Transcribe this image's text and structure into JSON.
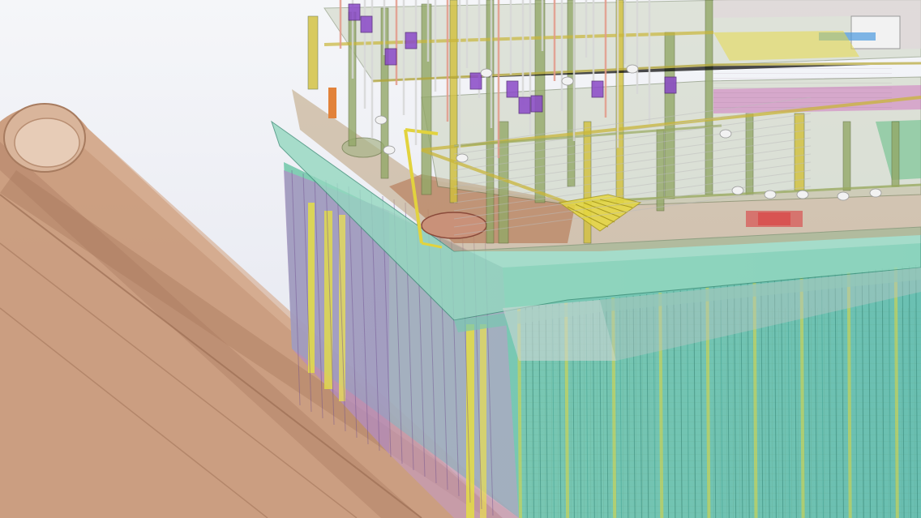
{
  "scene": {
    "view": "3d-model-viewport",
    "colors": {
      "background_top": "#f4f5f8",
      "background_bottom": "#e3e5ee",
      "tunnel": "#c79876",
      "tunnel_shadow": "#a8765a",
      "tunnel_light": "#ddb79c",
      "wall_green": "#59c2a6",
      "wall_teal": "#4eb7b3",
      "wall_yellow": "#e6df48",
      "wall_purple": "#b08ac8",
      "wall_pink": "#d7a8c8",
      "slab_green": "#9fdcc4",
      "slab_brown": "#b98463",
      "structure_yellow": "#d8c23a",
      "structure_olive": "#8ea35a",
      "pipe_grey": "#c9c9c9",
      "equipment_purple": "#8a49c8",
      "floor_magenta": "#c96fc0",
      "floor_red": "#d84a4a",
      "accent_orange": "#e2823a",
      "roof_grey": "#cfcfd2"
    },
    "icons": []
  }
}
